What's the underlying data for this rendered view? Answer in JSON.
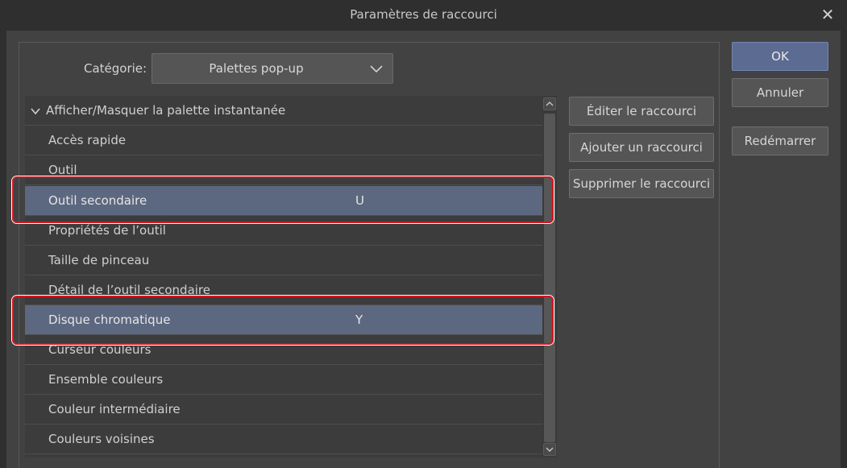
{
  "window": {
    "title": "Paramètres de raccourci"
  },
  "category": {
    "label": "Catégorie:",
    "selected": "Palettes pop-up"
  },
  "list": {
    "group": {
      "label": "Afficher/Masquer la palette instantanée",
      "expanded": true
    },
    "items": [
      {
        "label": "Accès rapide",
        "shortcut": ""
      },
      {
        "label": "Outil",
        "shortcut": ""
      },
      {
        "label": "Outil secondaire",
        "shortcut": "U",
        "selected": true,
        "highlighted": true
      },
      {
        "label": "Propriétés de l’outil",
        "shortcut": ""
      },
      {
        "label": "Taille de pinceau",
        "shortcut": ""
      },
      {
        "label": "Détail de l’outil secondaire",
        "shortcut": ""
      },
      {
        "label": "Disque chromatique",
        "shortcut": "Y",
        "selected": true,
        "highlighted": true
      },
      {
        "label": "Curseur couleurs",
        "shortcut": ""
      },
      {
        "label": "Ensemble couleurs",
        "shortcut": ""
      },
      {
        "label": "Couleur intermédiaire",
        "shortcut": ""
      },
      {
        "label": "Couleurs voisines",
        "shortcut": ""
      }
    ]
  },
  "actions": {
    "edit": "Éditer le raccourci",
    "add": "Ajouter un raccourci",
    "delete": "Supprimer le raccourci"
  },
  "dialog_buttons": {
    "ok": "OK",
    "cancel": "Annuler",
    "restart": "Redémarrer"
  },
  "colors": {
    "background": "#424242",
    "selection": "#5c6880",
    "primary_button": "#5c6b91",
    "annotation_box": "#d7141e"
  }
}
